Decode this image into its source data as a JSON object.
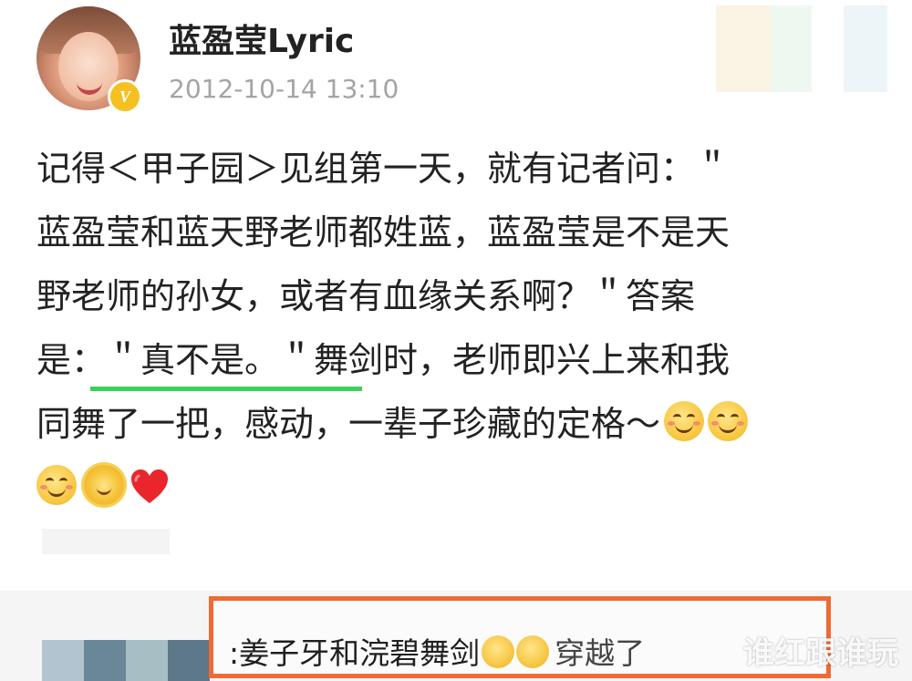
{
  "post": {
    "username": "蓝盈莹Lyric",
    "timestamp": "2012-10-14 13:10",
    "verified_badge": "V",
    "lines": [
      "记得＜甲子园＞见组第一天，就有记者问：＂",
      "蓝盈莹和蓝天野老师都姓蓝，蓝盈莹是不是天",
      "野老师的孙女，或者有血缘关系啊？＂答案",
      "是：＂真不是。＂舞剑时，老师即兴上来和我",
      "同舞了一把，感动，一辈子珍藏的定格～"
    ],
    "emojis": [
      "smile-emoji",
      "smile-emoji",
      "smile-emoji",
      "sun-emoji",
      "heart-emoji"
    ]
  },
  "comment": {
    "text": ":姜子牙和浣碧舞剑",
    "trailing_text": "穿越了"
  },
  "watermark": {
    "text": "谁红跟谁玩"
  },
  "colors": {
    "highlight_box": "#f06a33",
    "underline": "#3bd05a",
    "timestamp": "#a4a4a4",
    "badge": "#f7c021"
  }
}
